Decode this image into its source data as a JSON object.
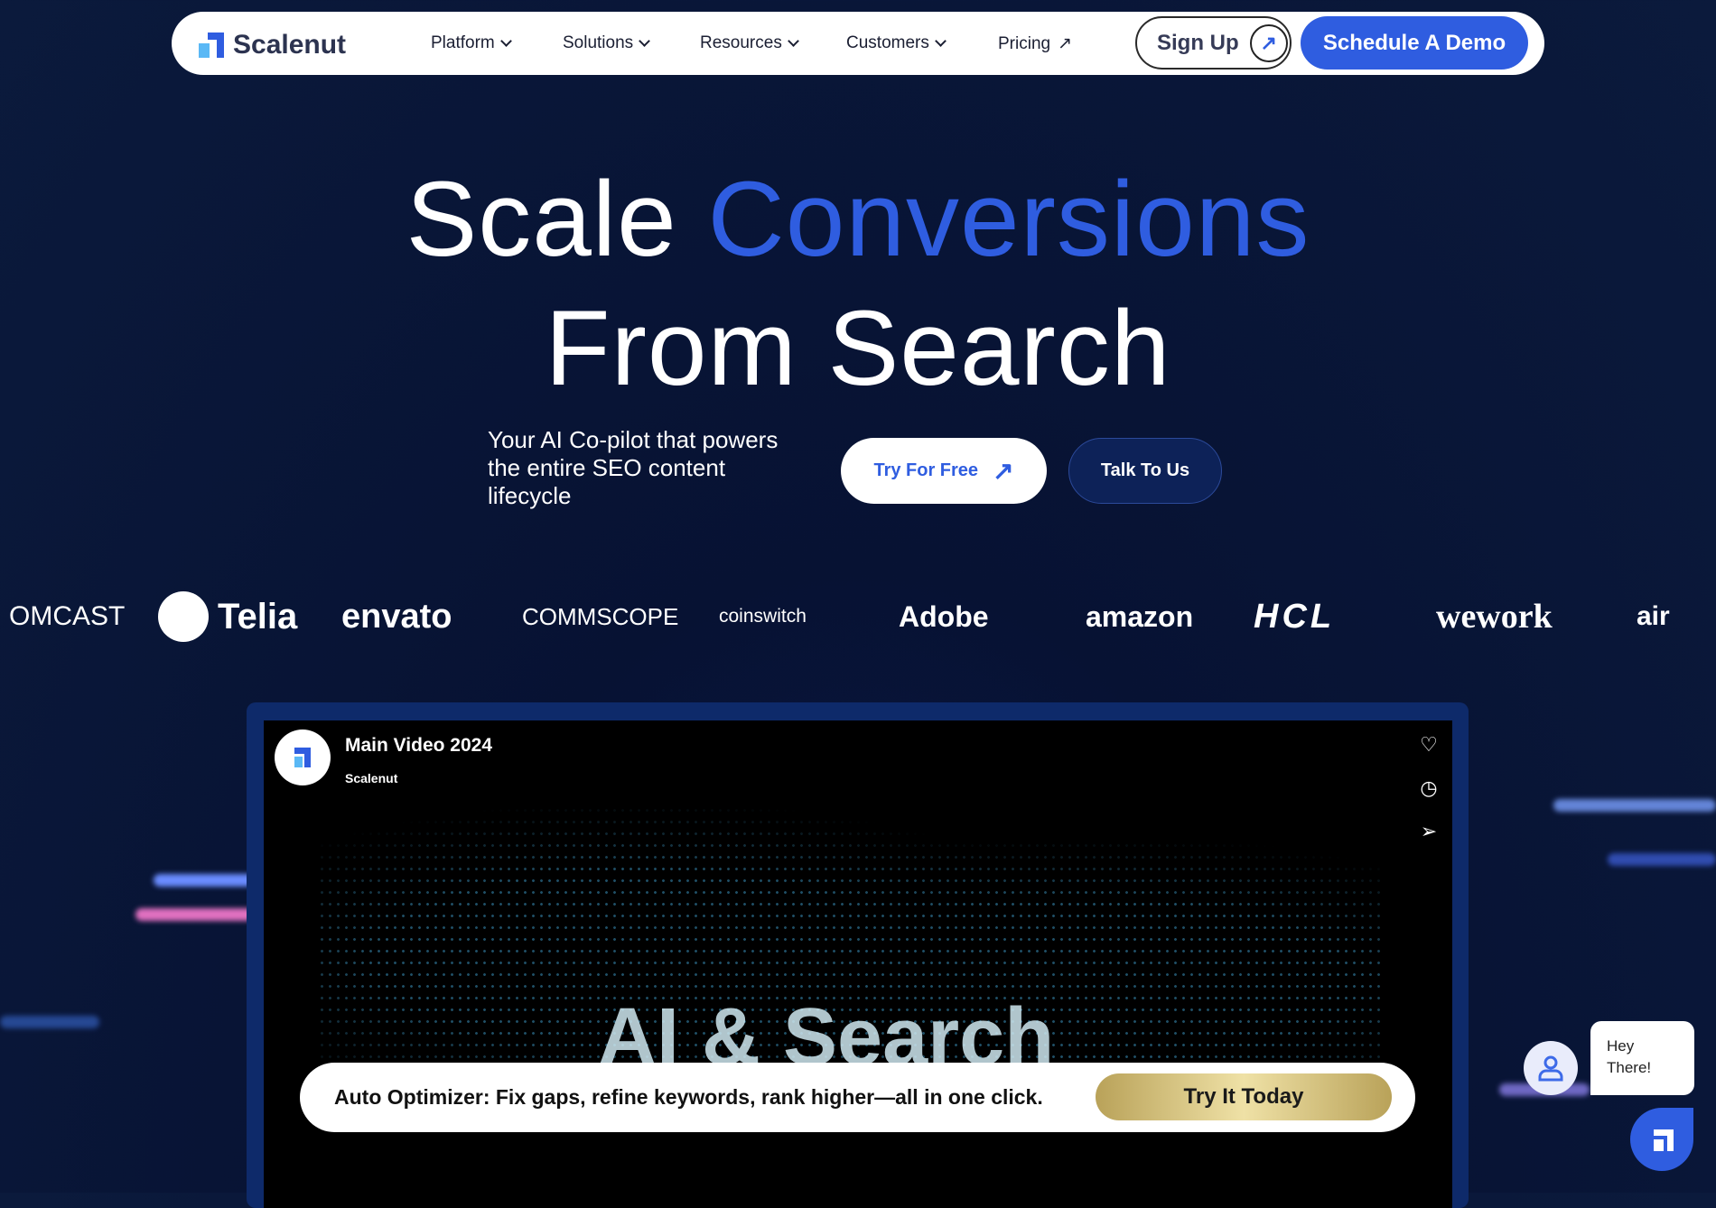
{
  "nav": {
    "brand": "Scalenut",
    "items": [
      {
        "label": "Platform"
      },
      {
        "label": "Solutions"
      },
      {
        "label": "Resources"
      },
      {
        "label": "Customers"
      },
      {
        "label": "Pricing"
      }
    ],
    "signup": "Sign Up",
    "demo": "Schedule A Demo"
  },
  "hero": {
    "line1_a": "Scale ",
    "line1_b": "Conversions",
    "line2": "From Search",
    "subtitle": "Your AI Co-pilot that powers the entire SEO content lifecycle",
    "try_free": "Try For Free",
    "talk": "Talk To Us",
    "accent": "#2f5de0"
  },
  "logos": [
    "OMCAST",
    "Telia",
    "envato",
    "COMMSCOPE",
    "coinswitch",
    "Adobe",
    "amazon",
    "HCL",
    "wework",
    "air"
  ],
  "video": {
    "title": "Main Video 2024",
    "channel": "Scalenut",
    "overlay_text": "AI & Search",
    "banner_text": "Auto Optimizer: Fix gaps, refine keywords, rank higher—all in one click.",
    "banner_cta": "Try It Today"
  },
  "chat": {
    "greeting": "Hey There!"
  }
}
